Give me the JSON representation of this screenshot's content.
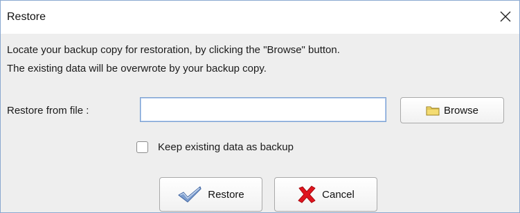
{
  "window": {
    "title": "Restore",
    "close_icon": "close-icon"
  },
  "message": {
    "line1": "Locate your backup copy for restoration, by clicking the \"Browse\" button.",
    "line2": "The existing data will be overwrote by your backup copy."
  },
  "file": {
    "label": "Restore from file :",
    "value": "",
    "browse_label": "Browse",
    "browse_icon": "folder-icon"
  },
  "keep_backup": {
    "label": "Keep existing data as backup",
    "checked": false
  },
  "actions": {
    "restore_label": "Restore",
    "restore_icon": "checkmark-icon",
    "cancel_label": "Cancel",
    "cancel_icon": "red-x-icon"
  },
  "colors": {
    "dialog_bg": "#eeeeee",
    "titlebar_bg": "#ffffff",
    "input_focus_border": "#7a9fd0",
    "window_border": "#8aa8d0",
    "cancel_x": "#e0141e",
    "check_blue": "#6a8cc0"
  }
}
